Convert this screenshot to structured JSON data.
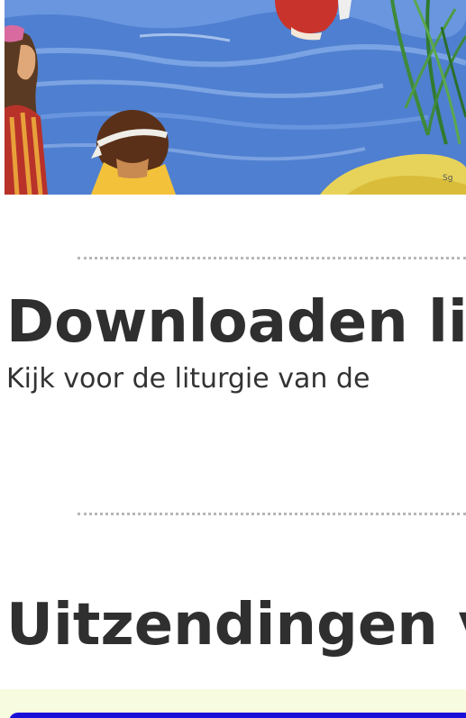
{
  "hero": {
    "image_name": "baptism-illustration",
    "signature": "Sg"
  },
  "sections": {
    "download": {
      "title": "Downloaden li",
      "text": "Kijk voor de liturgie van de"
    },
    "broadcasts": {
      "title": "Uitzendingen v"
    }
  },
  "colors": {
    "heading": "#2f2f2f",
    "divider": "#b7b7b7",
    "player_background": "#f7fbe0",
    "player_bar": "#1a10d8"
  }
}
